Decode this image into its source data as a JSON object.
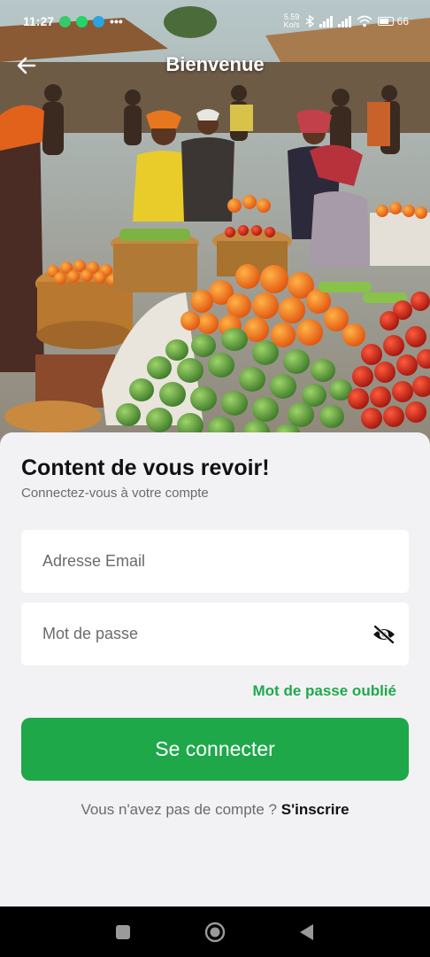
{
  "status_bar": {
    "time": "11:27",
    "network_speed_value": "5.59",
    "network_speed_unit": "Ko/s",
    "battery": "66",
    "more_dots": "•••",
    "notification_icons": [
      "messenger-icon",
      "whatsapp-icon",
      "telegram-icon"
    ]
  },
  "app_bar": {
    "title": "Bienvenue",
    "back_icon": "arrow-left-icon"
  },
  "form": {
    "title": "Content de vous revoir!",
    "subtitle": "Connectez-vous à votre compte",
    "email_placeholder": "Adresse Email",
    "email_value": "",
    "password_placeholder": "Mot de passe",
    "password_value": "",
    "password_toggle_icon": "eye-off-icon",
    "forgot_label": "Mot de passe oublié",
    "login_label": "Se connecter",
    "signup_prompt": "Vous n'avez pas de compte ? ",
    "signup_link": "S'inscrire"
  },
  "colors": {
    "accent": "#1faa4a",
    "button": "#1ea84a",
    "background": "#f2f2f5"
  },
  "nav_bar": {
    "buttons": [
      "recents-icon",
      "home-icon",
      "back-triangle-icon"
    ]
  }
}
